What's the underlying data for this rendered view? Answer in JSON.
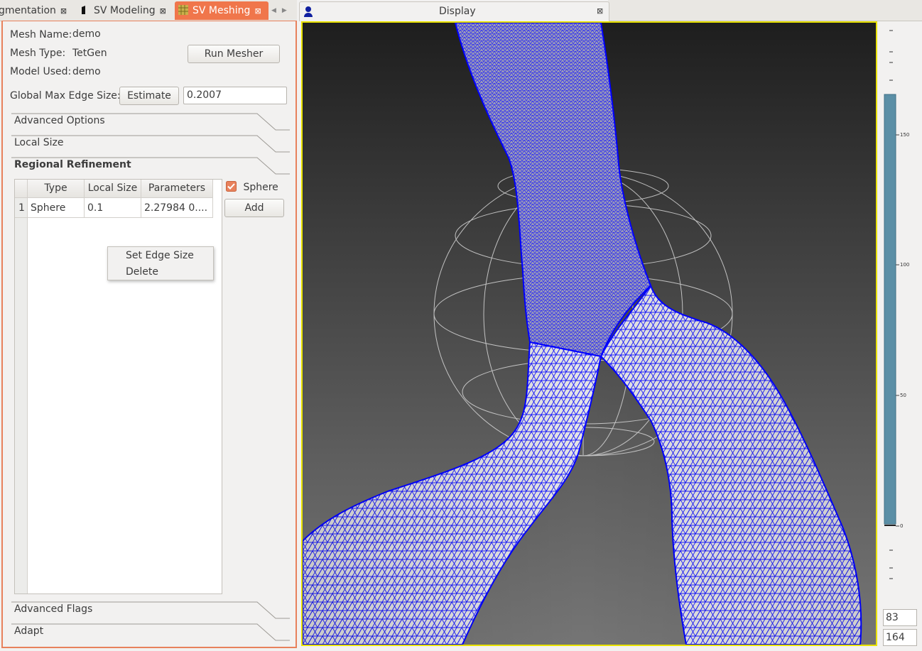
{
  "tabs": {
    "segmentation": "gmentation",
    "modeling": "SV Modeling",
    "meshing": "SV Meshing",
    "close_glyph": "⊠"
  },
  "mesh": {
    "name_label": "Mesh Name:",
    "name_value": "demo",
    "type_label": "Mesh Type:",
    "type_value": "TetGen",
    "model_label": "Model Used:",
    "model_value": "demo",
    "run_mesher": "Run Mesher",
    "edge_label": "Global Max Edge Size:",
    "estimate": "Estimate",
    "edge_value": "0.2007"
  },
  "sections": {
    "advanced_options": "Advanced Options",
    "local_size": "Local Size",
    "regional_refinement": "Regional Refinement",
    "advanced_flags": "Advanced Flags",
    "adapt": "Adapt"
  },
  "refinement_table": {
    "headers": [
      "Type",
      "Local Size",
      "Parameters"
    ],
    "rows": [
      {
        "index": "1",
        "type": "Sphere",
        "local_size": "0.1",
        "parameters": "2.27984 0...."
      }
    ]
  },
  "sphere_checkbox": {
    "label": "Sphere",
    "checked": true
  },
  "add_button": "Add",
  "context_menu": {
    "set_edge_size": "Set Edge Size",
    "delete": "Delete"
  },
  "display": {
    "title": "Display"
  },
  "slider": {
    "ticks": [
      "150",
      "100",
      "50",
      "0"
    ],
    "value_top": "83",
    "value_bottom": "164"
  },
  "colors": {
    "accent": "#e8815c",
    "tab_active": "#f0764b",
    "mesh_lines": "#0000ff",
    "viewport_border": "#e9e200",
    "slider_bar": "#5b8fa6"
  }
}
